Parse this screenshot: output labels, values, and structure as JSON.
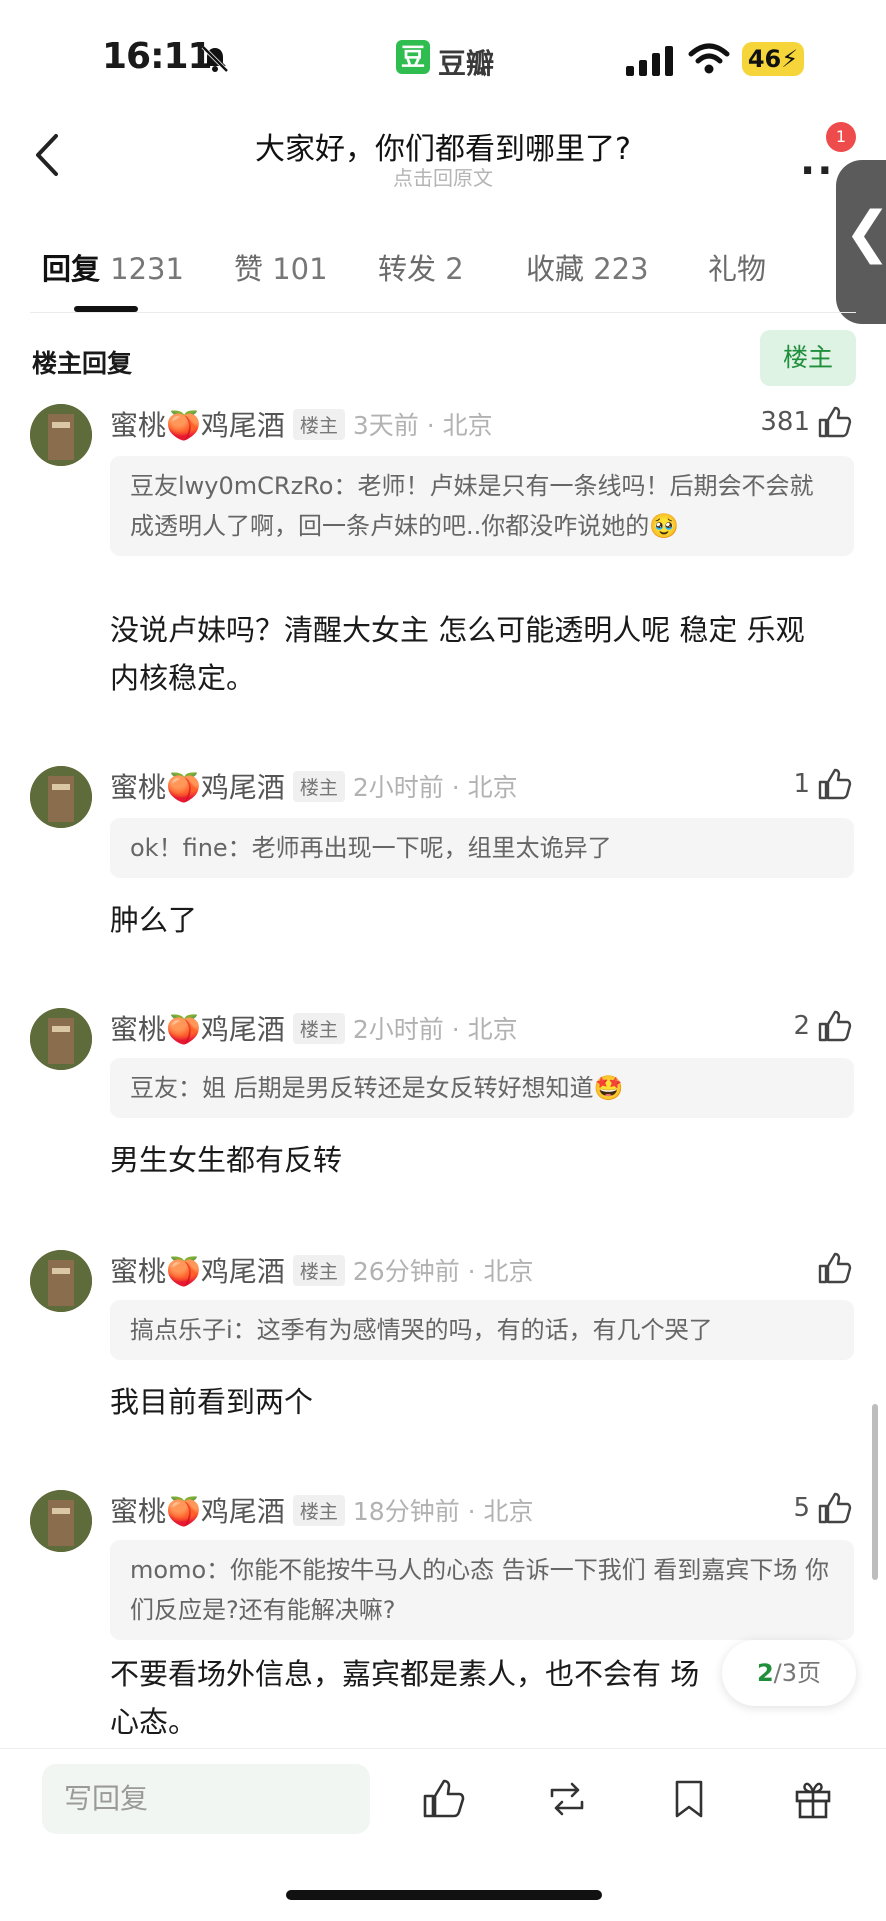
{
  "status_bar": {
    "time": "16:11",
    "app_name": "豆瓣",
    "app_logo_char": "豆",
    "battery": "46"
  },
  "nav": {
    "title": "大家好，你们都看到哪里了?",
    "subtitle": "点击回原文",
    "badge": "1"
  },
  "tabs": [
    {
      "label": "回复",
      "count": "1231",
      "active": true
    },
    {
      "label": "赞",
      "count": "101"
    },
    {
      "label": "转发",
      "count": "2"
    },
    {
      "label": "收藏",
      "count": "223"
    },
    {
      "label": "礼物",
      "count": ""
    }
  ],
  "section": {
    "title": "楼主回复",
    "filter_label": "楼主"
  },
  "comments": [
    {
      "username": "蜜桃🍑鸡尾酒",
      "op_tag": "楼主",
      "meta": "3天前 · 北京",
      "likes": "381",
      "quote": "豆友lwy0mCRzRo：老师！卢妹是只有一条线吗！后期会不会就成透明人了啊，回一条卢妹的吧..你都没咋说她的🥹",
      "text": "没说卢妹吗？清醒大女主 怎么可能透明人呢 稳定 乐观 内核稳定。"
    },
    {
      "username": "蜜桃🍑鸡尾酒",
      "op_tag": "楼主",
      "meta": "2小时前 · 北京",
      "likes": "1",
      "quote": "ok！fine：老师再出现一下呢，组里太诡异了",
      "text": "肿么了"
    },
    {
      "username": "蜜桃🍑鸡尾酒",
      "op_tag": "楼主",
      "meta": "2小时前 · 北京",
      "likes": "2",
      "quote": "豆友：姐 后期是男反转还是女反转好想知道🤩",
      "text": "男生女生都有反转"
    },
    {
      "username": "蜜桃🍑鸡尾酒",
      "op_tag": "楼主",
      "meta": "26分钟前 · 北京",
      "likes": "",
      "quote": "搞点乐子i：这季有为感情哭的吗，有的话，有几个哭了",
      "text": "我目前看到两个"
    },
    {
      "username": "蜜桃🍑鸡尾酒",
      "op_tag": "楼主",
      "meta": "18分钟前 · 北京",
      "likes": "5",
      "quote": "momo：你能不能按牛马人的心态 告诉一下我们 看到嘉宾下场 你们反应是?还有能解决嘛?",
      "text": "不要看场外信息，嘉宾都是素人，也不会有 场心态。"
    }
  ],
  "pagination": {
    "current": "2",
    "total": "/3页"
  },
  "bottom_bar": {
    "reply_placeholder": "写回复"
  },
  "colors": {
    "accent_green": "#1f8f3b",
    "logo_green": "#2fbd4f",
    "badge_red": "#ee4c4c"
  }
}
